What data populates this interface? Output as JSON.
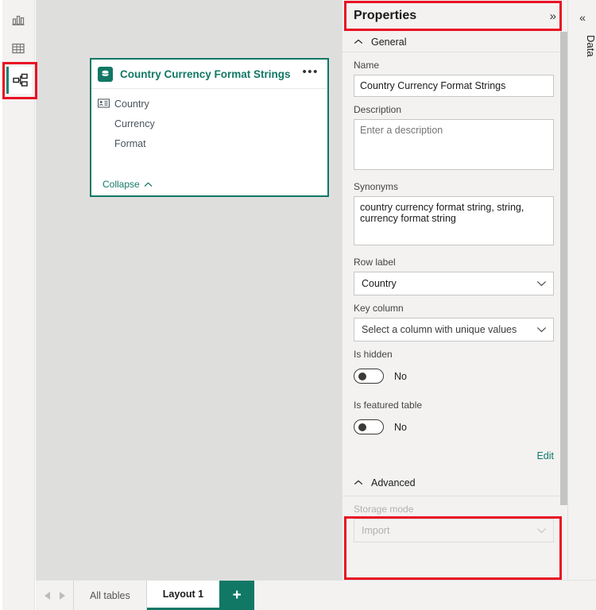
{
  "rail": {
    "items": [
      {
        "name": "report-view",
        "icon": "bar-chart-icon",
        "selected": false
      },
      {
        "name": "table-view",
        "icon": "grid-table-icon",
        "selected": false
      },
      {
        "name": "model-view",
        "icon": "model-relationship-icon",
        "selected": true
      }
    ]
  },
  "canvas": {
    "table_card": {
      "title": "Country Currency Format Strings",
      "icon": "table-database-icon",
      "more_label": "•••",
      "fields": [
        {
          "label": "Country",
          "icon": "row-label-card-icon",
          "has_icon": true
        },
        {
          "label": "Currency",
          "icon": "",
          "has_icon": false
        },
        {
          "label": "Format",
          "icon": "",
          "has_icon": false
        }
      ],
      "collapse_label": "Collapse"
    }
  },
  "properties": {
    "title": "Properties",
    "collapse_icon": "»",
    "sections": {
      "general": {
        "label": "General",
        "expanded": true,
        "name_label": "Name",
        "name_value": "Country Currency Format Strings",
        "description_label": "Description",
        "description_value": "",
        "description_placeholder": "Enter a description",
        "synonyms_label": "Synonyms",
        "synonyms_value": "country currency format string, string, currency format string",
        "row_label_label": "Row label",
        "row_label_value": "Country",
        "key_column_label": "Key column",
        "key_column_value": "Select a column with unique values",
        "is_hidden_label": "Is hidden",
        "is_hidden_value": "No",
        "is_featured_label": "Is featured table",
        "is_featured_value": "No",
        "edit_label": "Edit"
      },
      "advanced": {
        "label": "Advanced",
        "expanded": true,
        "storage_mode_label": "Storage mode",
        "storage_mode_value": "Import",
        "storage_mode_disabled": true
      }
    }
  },
  "data_rail": {
    "expand_icon": "«",
    "label": "Data"
  },
  "tabbar": {
    "prev_icon": "chevron-left-icon",
    "next_icon": "chevron-right-icon",
    "tabs": [
      {
        "label": "All tables",
        "active": false
      },
      {
        "label": "Layout 1",
        "active": true
      }
    ],
    "add_label": "+"
  },
  "colors": {
    "accent_teal": "#117865",
    "annotation_red": "#e81123",
    "panel_bg": "#f3f2f1",
    "canvas_bg": "#dededd"
  }
}
